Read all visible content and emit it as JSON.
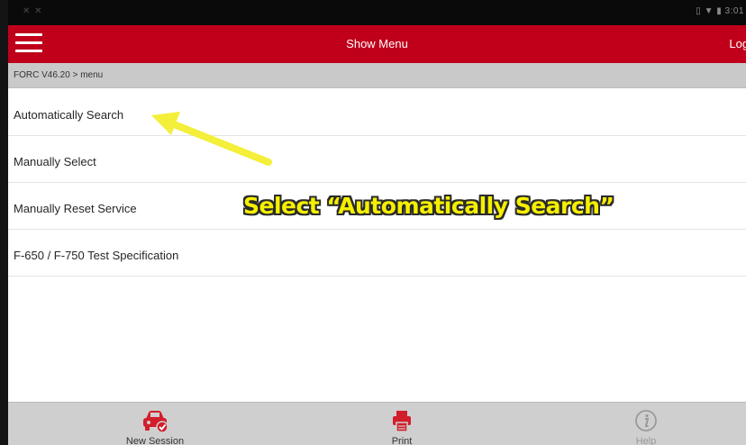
{
  "status_bar": {
    "left_icons": "✕ ✕",
    "right_text": "▯ ▼ ▮ 3:01"
  },
  "app_bar": {
    "title": "Show Menu",
    "login_label": "Logi"
  },
  "breadcrumb": {
    "text": "FORC V46.20 > menu"
  },
  "menu": {
    "items": [
      {
        "label": "Automatically Search"
      },
      {
        "label": "Manually Select"
      },
      {
        "label": "Manually Reset Service"
      },
      {
        "label": "F-650 / F-750 Test Specification"
      }
    ]
  },
  "overlay": {
    "caption": "Select “Automatically Search”",
    "arrow_color": "#f3ef3a"
  },
  "bottom_nav": {
    "new_session_label": "New Session",
    "print_label": "Print",
    "help_label": "Help"
  },
  "colors": {
    "brand_red": "#c0001b",
    "bottom_bar": "#cfcfcf",
    "breadcrumb_bg": "#c9c9c9"
  },
  "icons": {
    "menu": "hamburger-icon",
    "new_session": "car-check-icon",
    "print": "printer-icon",
    "help": "info-icon"
  }
}
